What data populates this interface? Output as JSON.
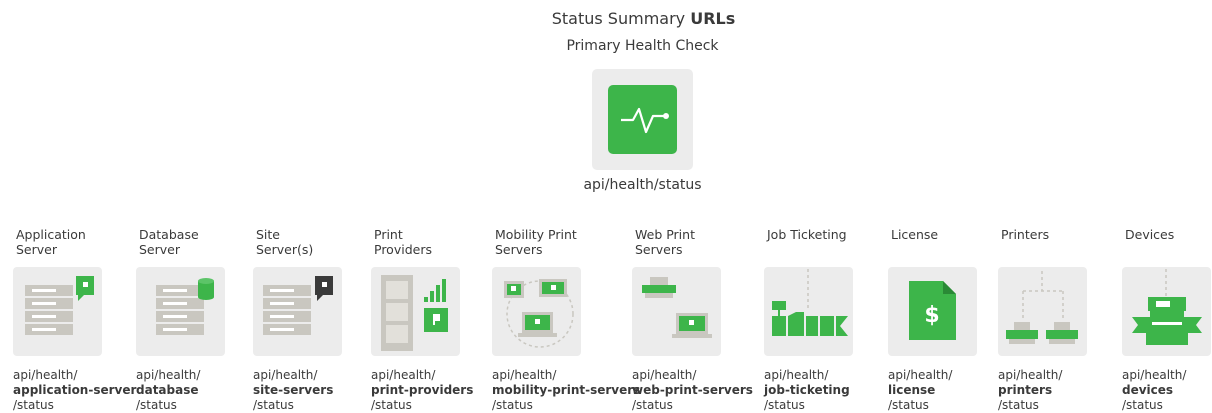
{
  "header": {
    "title_prefix": "Status Summary",
    "title_bold": "URLs",
    "subtitle": "Primary Health Check",
    "main_url": "api/health/status"
  },
  "colors": {
    "green": "#3db54a",
    "tile": "#ececec",
    "gray": "#c9c7c0",
    "dark": "#3a3a3a"
  },
  "endpoints": [
    {
      "label": "Application\nServer",
      "url_prefix": "api/health/",
      "url_bold": "application-server",
      "url_suffix": "/status",
      "icon": "app-server-icon"
    },
    {
      "label": "Database\nServer",
      "url_prefix": "api/health/",
      "url_bold": "database",
      "url_suffix": "/status",
      "icon": "database-server-icon"
    },
    {
      "label": "Site\nServer(s)",
      "url_prefix": "api/health/",
      "url_bold": "site-servers",
      "url_suffix": "/status",
      "icon": "site-server-icon"
    },
    {
      "label": "Print\nProviders",
      "url_prefix": "api/health/",
      "url_bold": "print-providers",
      "url_suffix": "/status",
      "icon": "print-provider-icon"
    },
    {
      "label": "Mobility Print\nServers",
      "url_prefix": "api/health/",
      "url_bold": "mobility-print-servers",
      "url_suffix": "/status",
      "icon": "mobility-print-icon"
    },
    {
      "label": "Web Print\nServers",
      "url_prefix": "api/health/",
      "url_bold": "web-print-servers",
      "url_suffix": "/status",
      "icon": "web-print-icon"
    },
    {
      "label": "Job Ticketing",
      "url_prefix": "api/health/",
      "url_bold": "job-ticketing",
      "url_suffix": "/status",
      "icon": "job-ticketing-icon"
    },
    {
      "label": "License",
      "url_prefix": "api/health/",
      "url_bold": "license",
      "url_suffix": "/status",
      "icon": "license-icon"
    },
    {
      "label": "Printers",
      "url_prefix": "api/health/",
      "url_bold": "printers",
      "url_suffix": "/status",
      "icon": "printers-icon"
    },
    {
      "label": "Devices",
      "url_prefix": "api/health/",
      "url_bold": "devices",
      "url_suffix": "/status",
      "icon": "devices-icon"
    }
  ]
}
